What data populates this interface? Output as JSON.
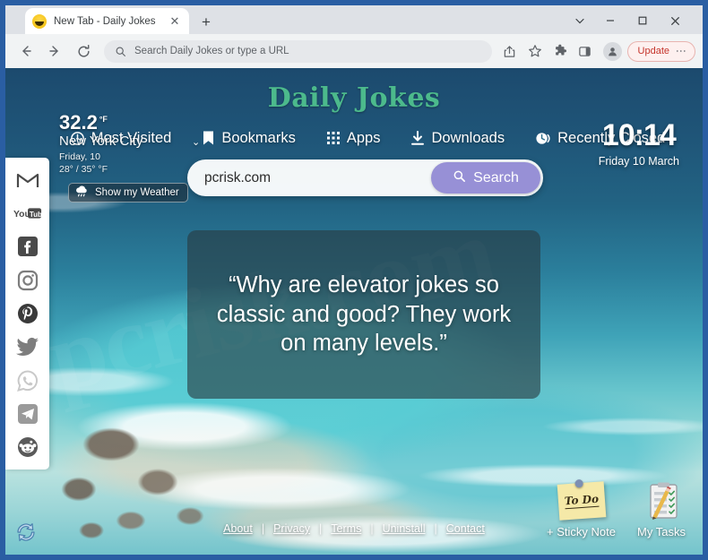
{
  "browser": {
    "tab": {
      "title": "New Tab - Daily Jokes",
      "favicon": "laughing-emoji-icon",
      "close": "✕"
    },
    "new_tab_label": "+",
    "window_controls": {
      "more": "⌄",
      "minimize": "–",
      "maximize": "□",
      "close": "✕"
    },
    "toolbar": {
      "back": "back-arrow-icon",
      "forward": "forward-arrow-icon",
      "reload": "reload-icon",
      "omnibox_placeholder": "Search Daily Jokes or type a URL",
      "share_icon": "share-icon",
      "bookmark_icon": "star-icon",
      "extensions_icon": "puzzle-icon",
      "side_panel_icon": "side-panel-icon",
      "profile_icon": "profile-avatar-icon",
      "update_label": "Update",
      "menu_dots": "⋮"
    }
  },
  "page": {
    "logo": "Daily Jokes",
    "watermark": "pcrisk.com",
    "top_nav": [
      {
        "label": "Most Visited",
        "icon": "clock-history-icon"
      },
      {
        "label": "Bookmarks",
        "icon": "bookmark-icon"
      },
      {
        "label": "Apps",
        "icon": "apps-grid-icon"
      },
      {
        "label": "Downloads",
        "icon": "download-icon"
      },
      {
        "label": "Recently Closed",
        "icon": "recently-closed-icon"
      }
    ],
    "weather": {
      "temperature": "32.2",
      "unit": "°F",
      "city": "New York City",
      "date": "Friday, 10",
      "range": "28° / 35° °F",
      "toggle_label": "Show my Weather",
      "toggle_icon": "cloud-rain-icon",
      "caret": "⌄"
    },
    "clock": {
      "time": "10:14",
      "date": "Friday 10 March"
    },
    "search": {
      "value": "pcrisk.com",
      "button_label": "Search",
      "button_icon": "search-icon",
      "accent_color": "#9790d6"
    },
    "joke": {
      "text": "“Why are elevator jokes so classic and good? They work on many levels.”"
    },
    "social_sidebar": [
      {
        "name": "gmail",
        "label": "Gmail"
      },
      {
        "name": "youtube",
        "label": "YouTube"
      },
      {
        "name": "facebook",
        "label": "Facebook"
      },
      {
        "name": "instagram",
        "label": "Instagram"
      },
      {
        "name": "pinterest",
        "label": "Pinterest"
      },
      {
        "name": "twitter",
        "label": "Twitter"
      },
      {
        "name": "whatsapp",
        "label": "WhatsApp"
      },
      {
        "name": "telegram",
        "label": "Telegram"
      },
      {
        "name": "reddit",
        "label": "Reddit"
      }
    ],
    "footer": {
      "links": [
        "About",
        "Privacy",
        "Terms",
        "Uninstall",
        "Contact"
      ],
      "separator": "|"
    },
    "sticky_note": {
      "caption": "+ Sticky Note",
      "note_text": "To Do"
    },
    "my_tasks": {
      "caption": "My Tasks",
      "icon": "clipboard-pencil-icon"
    },
    "reload_badge": {
      "icon": "refresh-circle-icon"
    },
    "logo_color": "#4cba8c"
  }
}
